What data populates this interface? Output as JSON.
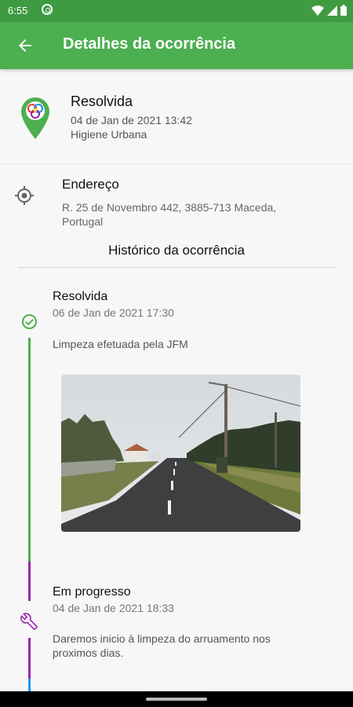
{
  "status_bar": {
    "time": "6:55"
  },
  "app_bar": {
    "title": "Detalhes da ocorrência"
  },
  "summary": {
    "status": "Resolvida",
    "datetime": "04 de Jan de 2021 13:42",
    "category": "Higiene Urbana"
  },
  "address": {
    "label": "Endereço",
    "text": "R. 25 de Novembro 442, 3885-713 Maceda, Portugal"
  },
  "history": {
    "title": "Histórico da ocorrência",
    "events": [
      {
        "status": "Resolvida",
        "datetime": "06 de Jan de 2021 17:30",
        "description": "Limpeza efetuada pela JFM",
        "icon": "check-circle-icon",
        "color": "#4caf50"
      },
      {
        "status": "Em progresso",
        "datetime": "04 de Jan de 2021 18:33",
        "description": "Daremos inicio à limpeza do arruamento nos proximos dias.",
        "icon": "wrench-icon",
        "color": "#9c27b0"
      }
    ]
  },
  "colors": {
    "primary": "#4caf50",
    "status_bar": "#3f9b42",
    "progress": "#9c27b0",
    "pending": "#2196f3"
  }
}
